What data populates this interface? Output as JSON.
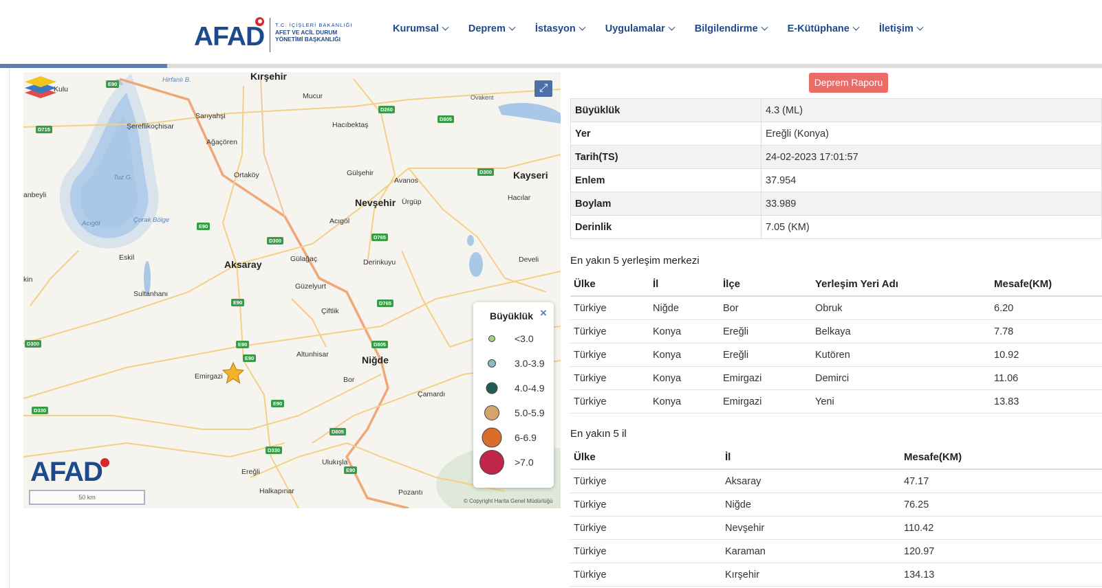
{
  "header": {
    "logo_text": "AFAD",
    "logo_sub_1": "T.C. İÇİŞLERİ BAKANLIĞI",
    "logo_sub_2": "AFET VE ACİL DURUM",
    "logo_sub_3": "YÖNETİMİ BAŞKANLIĞI",
    "nav": [
      "Kurumsal",
      "Deprem",
      "İstasyon",
      "Uygulamalar",
      "Bilgilendirme",
      "E-Kütüphane",
      "İletişim"
    ]
  },
  "map": {
    "places_big": [
      "Kırşehir",
      "Nevşehir",
      "Kayseri",
      "Aksaray",
      "Niğde"
    ],
    "places": [
      "Kulu",
      "Mucur",
      "Ovakent",
      "Sarıyahşi",
      "Şereflikoçhisar",
      "Hacıbektaş",
      "Ağaçören",
      "Gülşehir",
      "Avanos",
      "Ortaköy",
      "Ürgüp",
      "Hacılar",
      "Acıgöl",
      "Gülağaç",
      "Derinkuyu",
      "Develi",
      "Eskil",
      "Güzelyurt",
      "Sultanhanı",
      "Çiftlik",
      "Altunhisar",
      "Emirgazi",
      "Bor",
      "Çamardı",
      "Ulukışla",
      "Ereğli",
      "Halkapınar",
      "Pozantı",
      "anbeyli",
      "kin"
    ],
    "water": [
      "Tuz G.",
      "Acıgöl",
      "Çorak Bölge",
      "Hirfanlı B."
    ],
    "roads": [
      "E90",
      "D715",
      "D260",
      "D805",
      "D300",
      "E90",
      "D300",
      "D765",
      "E90",
      "D765",
      "E90",
      "E90",
      "D805",
      "D300",
      "E90",
      "D330",
      "D805",
      "D330",
      "E90"
    ],
    "logo": "AFAD",
    "scale": "50 km",
    "copyright": "© Copyright Harita Genel Müdürlüğü",
    "legend": {
      "title": "Büyüklük",
      "close": "×",
      "items": [
        {
          "label": "<3.0",
          "color": "#9bd27f"
        },
        {
          "label": "3.0-3.9",
          "color": "#8fb8bf"
        },
        {
          "label": "4.0-4.9",
          "color": "#1f5e57"
        },
        {
          "label": "5.0-5.9",
          "color": "#d4a46b"
        },
        {
          "label": "6-6.9",
          "color": "#d86d2c"
        },
        {
          "label": ">7.0",
          "color": "#c1274a"
        }
      ]
    }
  },
  "report_button": "Deprem Raporu",
  "info": [
    {
      "k": "Büyüklük",
      "v": "4.3 (ML)"
    },
    {
      "k": "Yer",
      "v": "Ereğli (Konya)"
    },
    {
      "k": "Tarih(TS)",
      "v": "24-02-2023 17:01:57"
    },
    {
      "k": "Enlem",
      "v": "37.954"
    },
    {
      "k": "Boylam",
      "v": "33.989"
    },
    {
      "k": "Derinlik",
      "v": "7.05 (KM)"
    }
  ],
  "nearest_settlements": {
    "title": "En yakın 5 yerleşim merkezi",
    "headers": [
      "Ülke",
      "İl",
      "İlçe",
      "Yerleşim Yeri Adı",
      "Mesafe(KM)"
    ],
    "rows": [
      [
        "Türkiye",
        "Niğde",
        "Bor",
        "Obruk",
        "6.20"
      ],
      [
        "Türkiye",
        "Konya",
        "Ereğli",
        "Belkaya",
        "7.78"
      ],
      [
        "Türkiye",
        "Konya",
        "Ereğli",
        "Kutören",
        "10.92"
      ],
      [
        "Türkiye",
        "Konya",
        "Emirgazi",
        "Demirci",
        "11.06"
      ],
      [
        "Türkiye",
        "Konya",
        "Emirgazi",
        "Yeni",
        "13.83"
      ]
    ]
  },
  "nearest_provinces": {
    "title": "En yakın 5 il",
    "headers": [
      "Ülke",
      "İl",
      "Mesafe(KM)"
    ],
    "rows": [
      [
        "Türkiye",
        "Aksaray",
        "47.17"
      ],
      [
        "Türkiye",
        "Niğde",
        "76.25"
      ],
      [
        "Türkiye",
        "Nevşehir",
        "110.42"
      ],
      [
        "Türkiye",
        "Karaman",
        "120.97"
      ],
      [
        "Türkiye",
        "Kırşehir",
        "134.13"
      ]
    ]
  }
}
